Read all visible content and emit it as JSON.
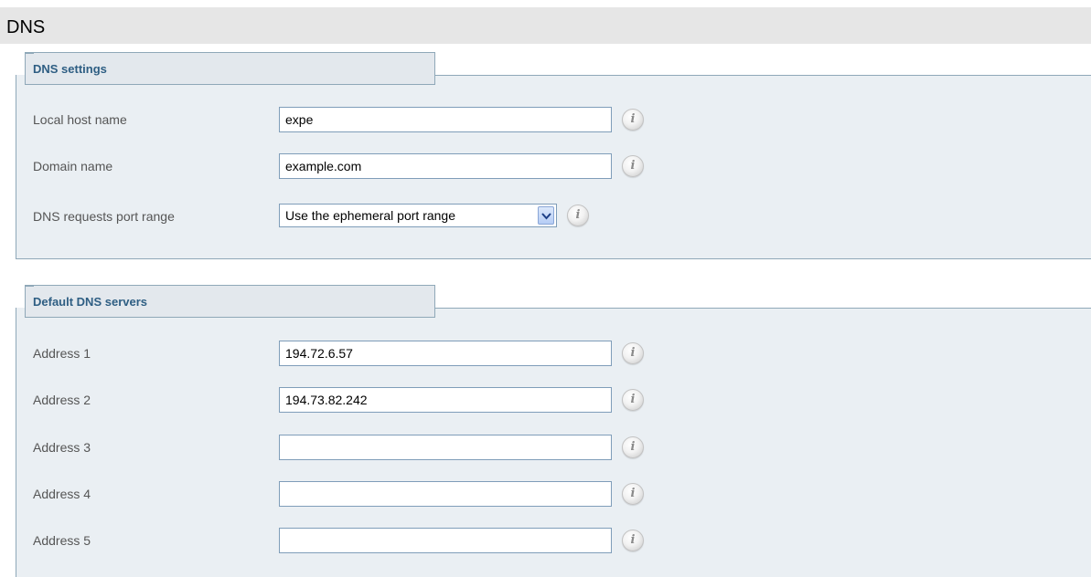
{
  "page": {
    "title": "DNS"
  },
  "dns_settings": {
    "legend": "DNS settings",
    "local_host_name": {
      "label": "Local host name",
      "value": "expe"
    },
    "domain_name": {
      "label": "Domain name",
      "value": "example.com"
    },
    "port_range": {
      "label": "DNS requests port range",
      "selected": "Use the ephemeral port range"
    }
  },
  "default_dns_servers": {
    "legend": "Default DNS servers",
    "addresses": [
      {
        "label": "Address 1",
        "value": "194.72.6.57"
      },
      {
        "label": "Address 2",
        "value": "194.73.82.242"
      },
      {
        "label": "Address 3",
        "value": ""
      },
      {
        "label": "Address 4",
        "value": ""
      },
      {
        "label": "Address 5",
        "value": ""
      }
    ]
  },
  "icons": {
    "info_glyph": "i",
    "dropdown": "chevron-down-icon"
  },
  "colors": {
    "legend_text": "#2e5e83",
    "panel_bg": "#eaeff3",
    "border": "#8fa8b8"
  }
}
